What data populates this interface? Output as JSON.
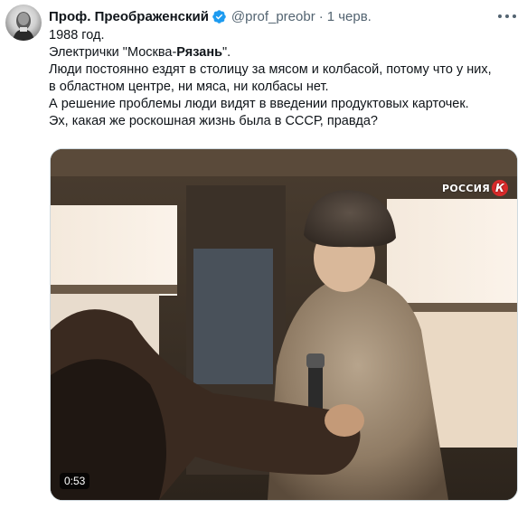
{
  "tweet": {
    "author_name": "Проф. Преображенский",
    "author_handle": "@prof_preobr",
    "separator": "·",
    "date": "1 черв.",
    "verified": true,
    "text_lines": [
      "1988 год.",
      "Электрички \"Москва-",
      "Рязань",
      "\".",
      "Люди постоянно ездят в столицу за мясом и колбасой, потому что у них,",
      "в областном центре, ни мяса, ни колбасы нет.",
      "А решение проблемы люди видят в введении продуктовых карточек.",
      "Эх, какая же роскошная жизнь была в СССР, правда?"
    ],
    "media": {
      "type": "video",
      "duration": "0:53",
      "channel_logo": "РОССИЯ",
      "channel_logo_mark": "К"
    }
  },
  "icons": {
    "verified": "verified-badge-icon",
    "more": "more-options-icon"
  },
  "colors": {
    "text": "#0f1419",
    "secondary": "#536471",
    "verified_blue": "#1d9bf0",
    "border": "#cfd9de"
  }
}
